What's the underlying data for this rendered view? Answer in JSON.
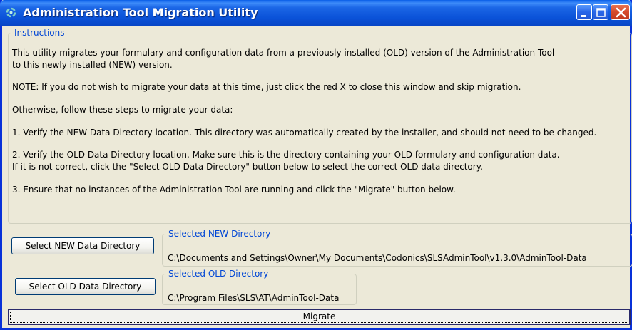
{
  "window": {
    "title": "Administration Tool Migration Utility",
    "icon": "app-icon",
    "controls": [
      "minimize-icon",
      "maximize-icon",
      "close-icon"
    ]
  },
  "instructions": {
    "legend": "Instructions",
    "paragraphs": [
      "This utility migrates your formulary and configuration data from a previously installed (OLD) version of the Administration Tool",
      "to this newly installed (NEW) version.",
      "NOTE: If you do not wish to migrate your data at this time, just click the red X to close this window and skip migration.",
      "Otherwise, follow these steps to migrate your data:",
      "1. Verify the NEW Data Directory location. This directory was automatically created by the installer, and should not need to be changed.",
      "2. Verify the OLD Data Directory location. Make sure this is the directory containing your OLD formulary and configuration data.",
      "If it is not correct, click the \"Select OLD Data Directory\" button below to select the correct OLD data directory.",
      "3. Ensure that no instances of the Administration Tool are running and click the \"Migrate\" button below."
    ]
  },
  "new_dir": {
    "button_label": "Select NEW Data Directory",
    "legend": "Selected NEW Directory",
    "path": "C:\\Documents and Settings\\Owner\\My Documents\\Codonics\\SLSAdminTool\\v1.3.0\\AdminTool-Data"
  },
  "old_dir": {
    "button_label": "Select OLD Data Directory",
    "legend": "Selected OLD Directory",
    "path": "C:\\Program Files\\SLS\\AT\\AdminTool-Data"
  },
  "migrate": {
    "label": "Migrate"
  },
  "colors": {
    "titlebar": "#0A52D8",
    "dialog_bg": "#ECE9D8",
    "legend_text": "#0046D5",
    "close_button": "#D54A2B"
  }
}
